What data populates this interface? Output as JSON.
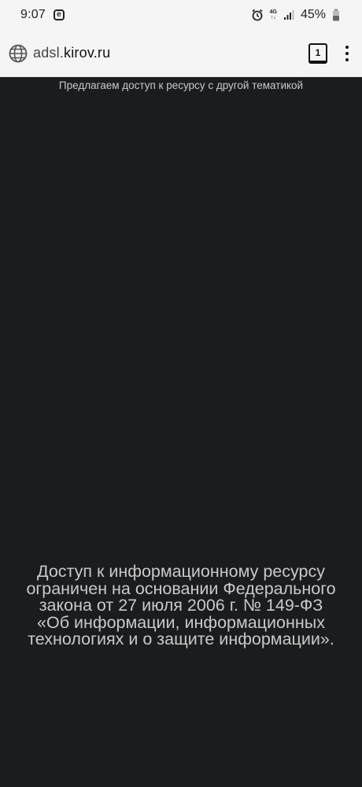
{
  "status_bar": {
    "time": "9:07",
    "notification_icon_letter": "e",
    "network_label_top": "4G",
    "network_label_bottom": "↑↓",
    "battery": "45%"
  },
  "browser": {
    "url_prefix": "adsl.",
    "url_host": "kirov.ru",
    "tab_count": "1"
  },
  "page": {
    "top_notice": "Предлагаем доступ к ресурсу с другой тематикой",
    "message_lines": [
      "Доступ к информационному ресурсу",
      "ограничен на основании Федерального",
      "закона от 27 июля 2006 г. № 149-ФЗ",
      "«Об информации, информационных",
      "технологиях и о защите информации»."
    ]
  },
  "colors": {
    "page_background": "#1b1c1e",
    "text": "#c9c9c9",
    "chrome_background": "#f5f5f5"
  }
}
